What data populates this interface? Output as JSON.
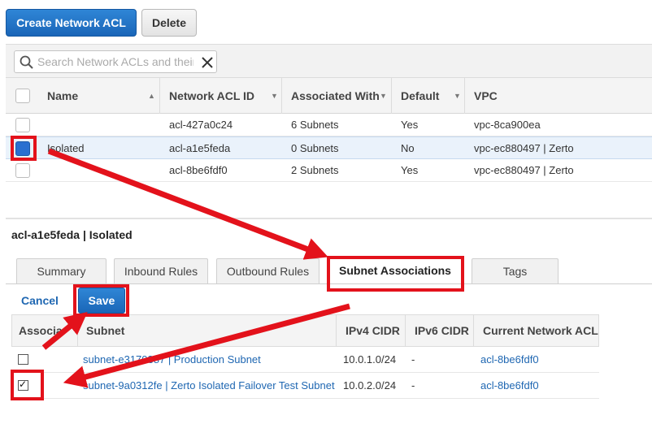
{
  "toolbar": {
    "create_label": "Create Network ACL",
    "delete_label": "Delete"
  },
  "search": {
    "placeholder": "Search Network ACLs and their",
    "value": ""
  },
  "grid": {
    "columns": [
      "Name",
      "Network ACL ID",
      "Associated With",
      "Default",
      "VPC"
    ],
    "rows": [
      {
        "name": "",
        "acl_id": "acl-427a0c24",
        "associated": "6 Subnets",
        "default": "Yes",
        "vpc": "vpc-8ca900ea",
        "selected": false
      },
      {
        "name": "Isolated",
        "acl_id": "acl-a1e5feda",
        "associated": "0 Subnets",
        "default": "No",
        "vpc": "vpc-ec880497 | Zerto",
        "selected": true
      },
      {
        "name": "",
        "acl_id": "acl-8be6fdf0",
        "associated": "2 Subnets",
        "default": "Yes",
        "vpc": "vpc-ec880497 | Zerto",
        "selected": false
      }
    ]
  },
  "detail": {
    "title": "acl-a1e5feda | Isolated",
    "tabs": [
      "Summary",
      "Inbound Rules",
      "Outbound Rules",
      "Subnet Associations",
      "Tags"
    ],
    "active_tab": "Subnet Associations",
    "cancel_label": "Cancel",
    "save_label": "Save"
  },
  "subnets": {
    "columns": [
      "Associa",
      "Subnet",
      "IPv4 CIDR",
      "IPv6 CIDR",
      "Current Network ACL"
    ],
    "rows": [
      {
        "checked": false,
        "subnet": "subnet-e3170387 | Production Subnet",
        "ipv4": "10.0.1.0/24",
        "ipv6": "-",
        "acl": "acl-8be6fdf0"
      },
      {
        "checked": true,
        "subnet": "subnet-9a0312fe | Zerto Isolated Failover Test Subnet",
        "ipv4": "10.0.2.0/24",
        "ipv6": "-",
        "acl": "acl-8be6fdf0"
      }
    ]
  },
  "colors": {
    "primary_button": "#1a66b8",
    "link": "#1f67b2",
    "annotation": "#e3121b",
    "selected_row": "#eaf2fb"
  },
  "icons": {
    "search": "search-icon",
    "clear": "clear-icon",
    "sort": "sort-caret-icon"
  }
}
